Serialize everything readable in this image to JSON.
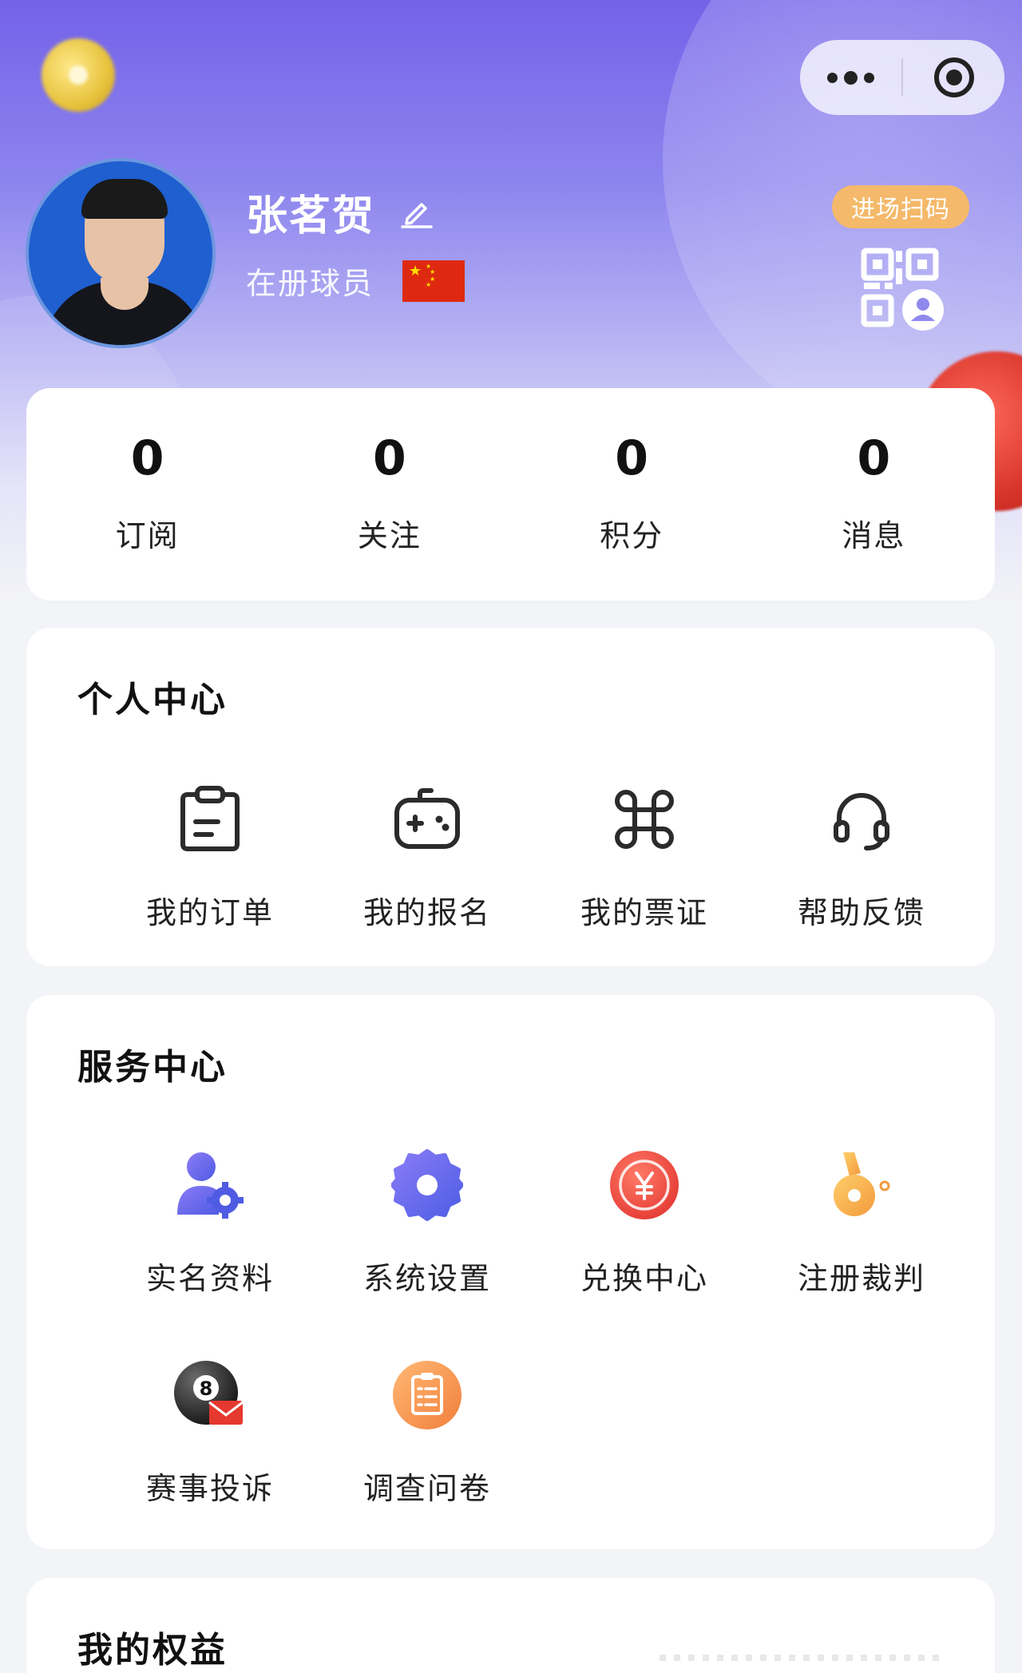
{
  "profile": {
    "name": "张茗贺",
    "status": "在册球员",
    "scan_badge": "进场扫码"
  },
  "stats": [
    {
      "value": "0",
      "label": "订阅"
    },
    {
      "value": "0",
      "label": "关注"
    },
    {
      "value": "0",
      "label": "积分"
    },
    {
      "value": "0",
      "label": "消息"
    }
  ],
  "personal_center": {
    "title": "个人中心",
    "items": [
      {
        "label": "我的订单",
        "icon": "clipboard-icon"
      },
      {
        "label": "我的报名",
        "icon": "gamepad-icon"
      },
      {
        "label": "我的票证",
        "icon": "command-icon"
      },
      {
        "label": "帮助反馈",
        "icon": "headset-icon"
      }
    ]
  },
  "service_center": {
    "title": "服务中心",
    "items": [
      {
        "label": "实名资料",
        "icon": "user-gear-icon"
      },
      {
        "label": "系统设置",
        "icon": "settings-gear-icon"
      },
      {
        "label": "兑换中心",
        "icon": "yuan-coin-icon"
      },
      {
        "label": "注册裁判",
        "icon": "whistle-icon"
      },
      {
        "label": "赛事投诉",
        "icon": "eight-ball-mail-icon"
      },
      {
        "label": "调查问卷",
        "icon": "survey-clipboard-icon"
      }
    ]
  },
  "my_rights": {
    "title": "我的权益"
  },
  "colors": {
    "header_top": "#7462e9",
    "accent_orange": "#f4b96a",
    "icon_purple": "#5b5ce8",
    "icon_red": "#e8463c",
    "icon_orange": "#f3a64a"
  }
}
